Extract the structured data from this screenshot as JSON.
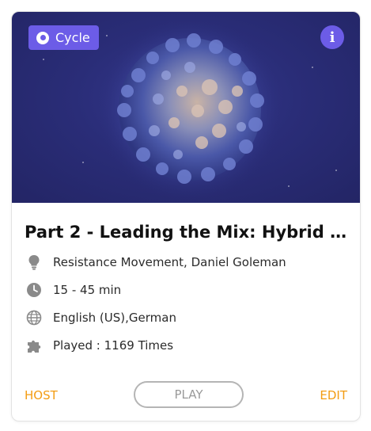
{
  "card": {
    "type_badge": "Cycle",
    "info_icon": "info-icon",
    "title": "Part 2 - Leading the Mix: Hybrid W...",
    "meta": [
      {
        "icon": "lightbulb-icon",
        "text": "Resistance Movement, Daniel Goleman"
      },
      {
        "icon": "clock-icon",
        "text": "15 - 45 min"
      },
      {
        "icon": "globe-icon",
        "text": "English (US),German"
      },
      {
        "icon": "puzzle-icon",
        "text": "Played : 1169 Times"
      }
    ],
    "actions": {
      "host": "HOST",
      "play": "PLAY",
      "edit": "EDIT"
    }
  },
  "colors": {
    "accent": "#6c5ce7",
    "link": "#f39c12",
    "hero_bg": "#2a2d78"
  }
}
